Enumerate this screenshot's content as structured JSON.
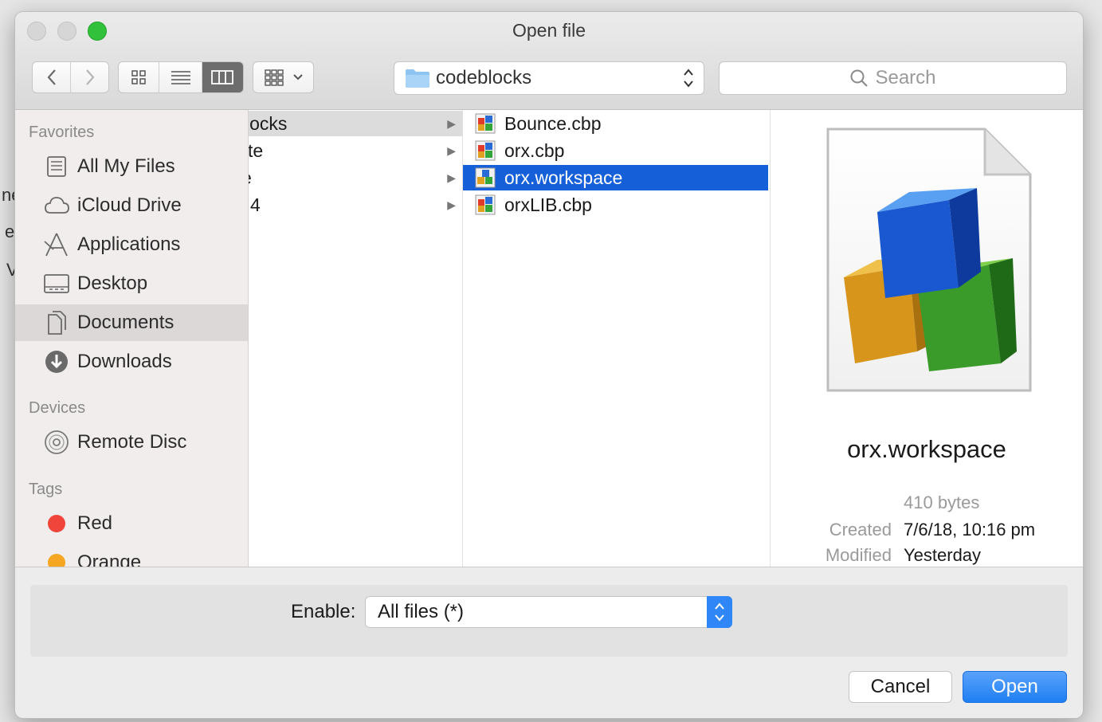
{
  "window": {
    "title": "Open file"
  },
  "toolbar": {
    "path_label": "codeblocks",
    "search_placeholder": "Search"
  },
  "sidebar": {
    "favorites_heading": "Favorites",
    "favorites": [
      {
        "label": "All My Files",
        "icon": "all-files-icon"
      },
      {
        "label": "iCloud Drive",
        "icon": "cloud-icon"
      },
      {
        "label": "Applications",
        "icon": "applications-icon"
      },
      {
        "label": "Desktop",
        "icon": "desktop-icon"
      },
      {
        "label": "Documents",
        "icon": "documents-icon"
      },
      {
        "label": "Downloads",
        "icon": "downloads-icon"
      }
    ],
    "devices_heading": "Devices",
    "devices": [
      {
        "label": "Remote Disc",
        "icon": "disc-icon"
      }
    ],
    "tags_heading": "Tags",
    "tags": [
      {
        "label": "Red",
        "color": "#f0453a"
      },
      {
        "label": "Orange",
        "color": "#f5a623"
      }
    ]
  },
  "column1": {
    "rows": [
      {
        "label": "locks",
        "selected": true
      },
      {
        "label": "te",
        "selected": false
      },
      {
        "label": "e",
        "selected": false
      },
      {
        "label": "4",
        "selected": false
      }
    ]
  },
  "column2": {
    "files": [
      {
        "name": "Bounce.cbp",
        "selected": false
      },
      {
        "name": "orx.cbp",
        "selected": false
      },
      {
        "name": "orx.workspace",
        "selected": true
      },
      {
        "name": "orxLIB.cbp",
        "selected": false
      }
    ]
  },
  "preview": {
    "filename": "orx.workspace",
    "size": "410 bytes",
    "created_label": "Created",
    "created_value": "7/6/18, 10:16 pm",
    "modified_label": "Modified",
    "modified_value": "Yesterday"
  },
  "bottom": {
    "enable_label": "Enable:",
    "enable_value": "All files (*)",
    "cancel_label": "Cancel",
    "open_label": "Open"
  },
  "colors": {
    "selection": "#1560d9",
    "open_button": "#2f86f6",
    "close_light": "#d4d4d4",
    "zoom_light": "#31c13a"
  }
}
